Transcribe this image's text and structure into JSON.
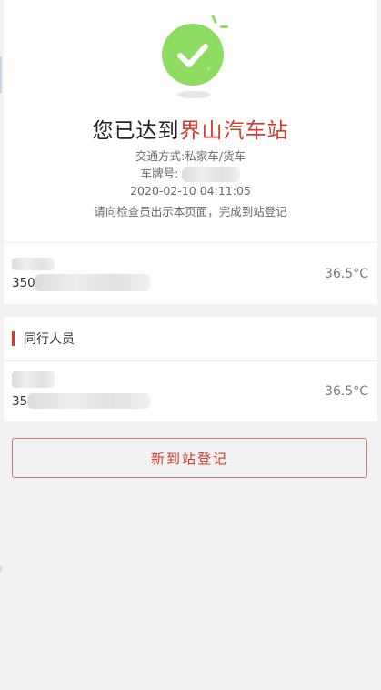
{
  "header": {
    "title_prefix": "您已达到",
    "station_name": "界山汽车站",
    "transport_line": "交通方式:私家车/货车",
    "plate_label": "车牌号:",
    "datetime": "2020-02-10 04:11:05",
    "instruction": "请向检查员出示本页面，完成到站登记"
  },
  "primary_person": {
    "id_prefix": "350",
    "temperature": "36.5°C"
  },
  "companions": {
    "section_title": "同行人员",
    "items": [
      {
        "id_prefix": "35",
        "temperature": "36.5°C"
      }
    ]
  },
  "actions": {
    "new_registration_label": "新到站登记"
  },
  "colors": {
    "accent_red": "#d23a2c",
    "success_green": "#8fdc63"
  },
  "icons": {
    "status": "check-circle-icon"
  }
}
